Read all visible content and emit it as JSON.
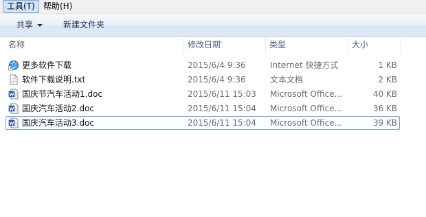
{
  "menubar": {
    "items": [
      {
        "label": "工具(T)",
        "active": true
      },
      {
        "label": "帮助(H)",
        "active": false
      }
    ]
  },
  "toolbar": {
    "share_label": "共享",
    "new_folder_label": "新建文件夹"
  },
  "columns": {
    "name": "名称",
    "date": "修改日期",
    "type": "类型",
    "size": "大小",
    "sorted_by": "修改日期"
  },
  "files": [
    {
      "name": "更多软件下载",
      "date": "2015/6/4 9:36",
      "type": "Internet 快捷方式",
      "size": "1 KB",
      "icon": "internet-shortcut-icon"
    },
    {
      "name": "软件下载说明.txt",
      "date": "2015/6/4 9:36",
      "type": "文本文档",
      "size": "2 KB",
      "icon": "text-document-icon"
    },
    {
      "name": "国庆节汽车活动1.doc",
      "date": "2015/6/11 15:03",
      "type": "Microsoft Office...",
      "size": "40 KB",
      "icon": "word-document-icon"
    },
    {
      "name": "国庆汽车活动2.doc",
      "date": "2015/6/11 15:04",
      "type": "Microsoft Office...",
      "size": "36 KB",
      "icon": "word-document-icon"
    },
    {
      "name": "国庆汽车活动3.doc",
      "date": "2015/6/11 15:04",
      "type": "Microsoft Office...",
      "size": "39 KB",
      "icon": "word-document-icon",
      "selected": true
    }
  ],
  "colors": {
    "menu_active_bg": "#cfe3fa",
    "selection_border": "#7da2ce",
    "header_text": "#4c607a"
  }
}
